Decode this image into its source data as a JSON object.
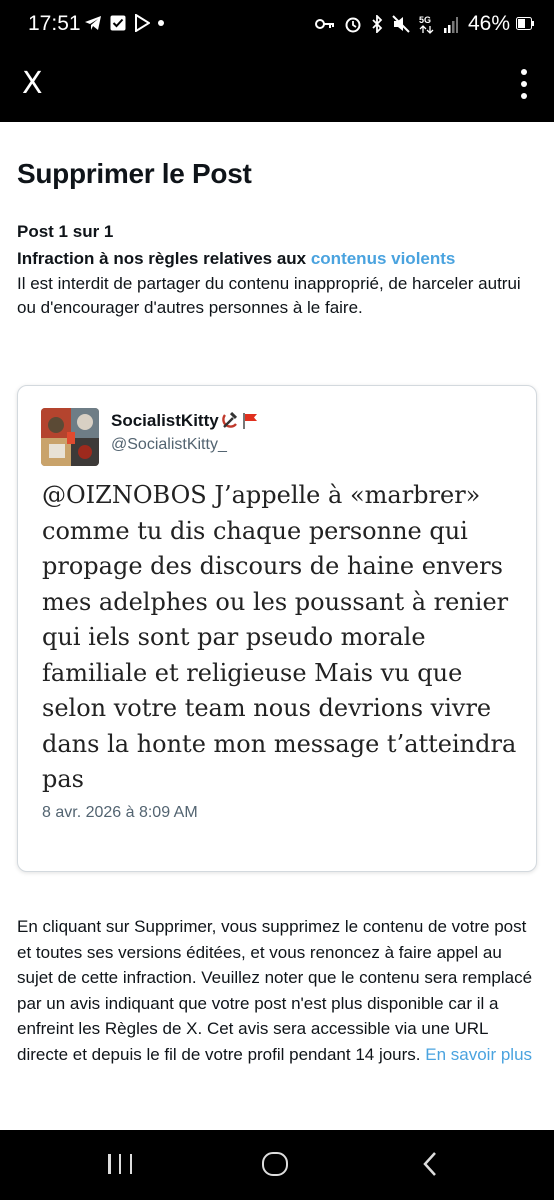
{
  "status_bar": {
    "time": "17:51",
    "battery": "46%"
  },
  "app_bar": {
    "close_label": "X"
  },
  "page": {
    "title": "Supprimer le Post",
    "post_count": "Post 1 sur 1",
    "infraction_prefix": "Infraction à nos règles relatives aux ",
    "infraction_link": "contenus violents",
    "infraction_description": "Il est interdit de partager du contenu inapproprié, de harceler autrui ou d'encourager d'autres personnes à le faire."
  },
  "post": {
    "display_name": "SocialistKitty",
    "handle": "@SocialistKitty_",
    "text": "@OIZNOBOS J’appelle à «marbrer» comme tu dis chaque personne qui propage des discours de haine envers mes adelphes ou les poussant à renier qui iels sont par pseudo morale familiale et religieuse Mais vu que selon votre team nous devrions vivre dans la honte mon message t’atteindra pas",
    "date": "8 avr. 2026 à 8:09 AM"
  },
  "footer": {
    "text": "En cliquant sur Supprimer, vous supprimez le contenu de votre post et toutes ses versions éditées, et vous renoncez à faire appel au sujet de cette infraction. Veuillez noter que le contenu sera remplacé par un avis indiquant que votre post n'est plus disponible car il a enfreint les Règles de X. Cet avis sera accessible via une URL directe et depuis le fil de votre profil pendant 14 jours. ",
    "learn_more": "En savoir plus"
  },
  "colors": {
    "link": "#4aa3df",
    "text": "#0f1419",
    "muted": "#536471"
  }
}
